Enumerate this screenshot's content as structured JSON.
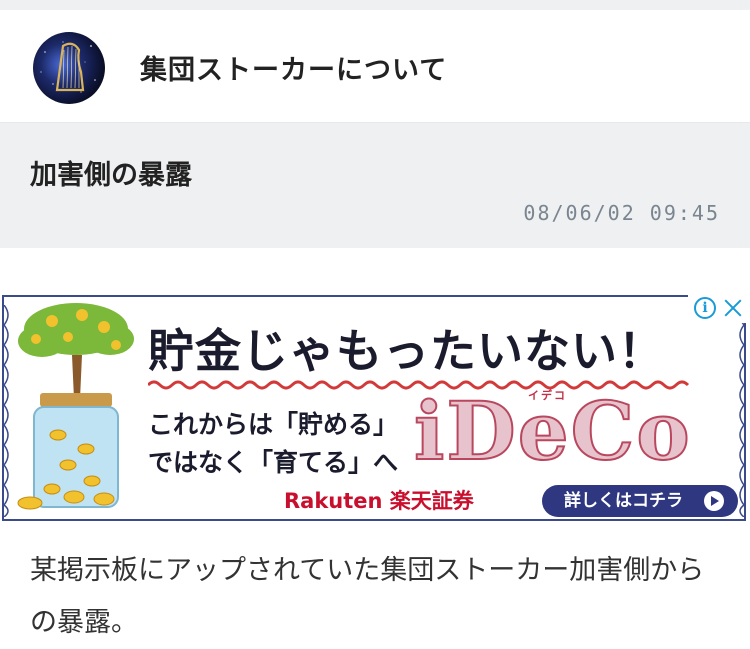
{
  "blog": {
    "title": "集団ストーカーについて",
    "avatar_icon": "harp-galaxy-avatar"
  },
  "post": {
    "title": "加害側の暴露",
    "date": "08/06/02 09:45",
    "body": "某掲示板にアップされていた集団ストーカー加害側からの暴露。"
  },
  "ad": {
    "headline": "貯金じゃもったいない！",
    "line1": "これからは「貯める」",
    "line2": "ではなく「育てる」へ",
    "brand": "iDeCo",
    "brand_ruby": "イデコ",
    "sponsor": "Rakuten 楽天証券",
    "cta_label": "詳しくはコチラ",
    "info_icon": "info-icon",
    "close_icon": "close-icon"
  },
  "colors": {
    "header_bg": "#eef0f2",
    "date_text": "#7a8590",
    "ad_navy": "#2e3780",
    "ad_red": "#c8102e",
    "adchoices_blue": "#1a9bd7"
  }
}
